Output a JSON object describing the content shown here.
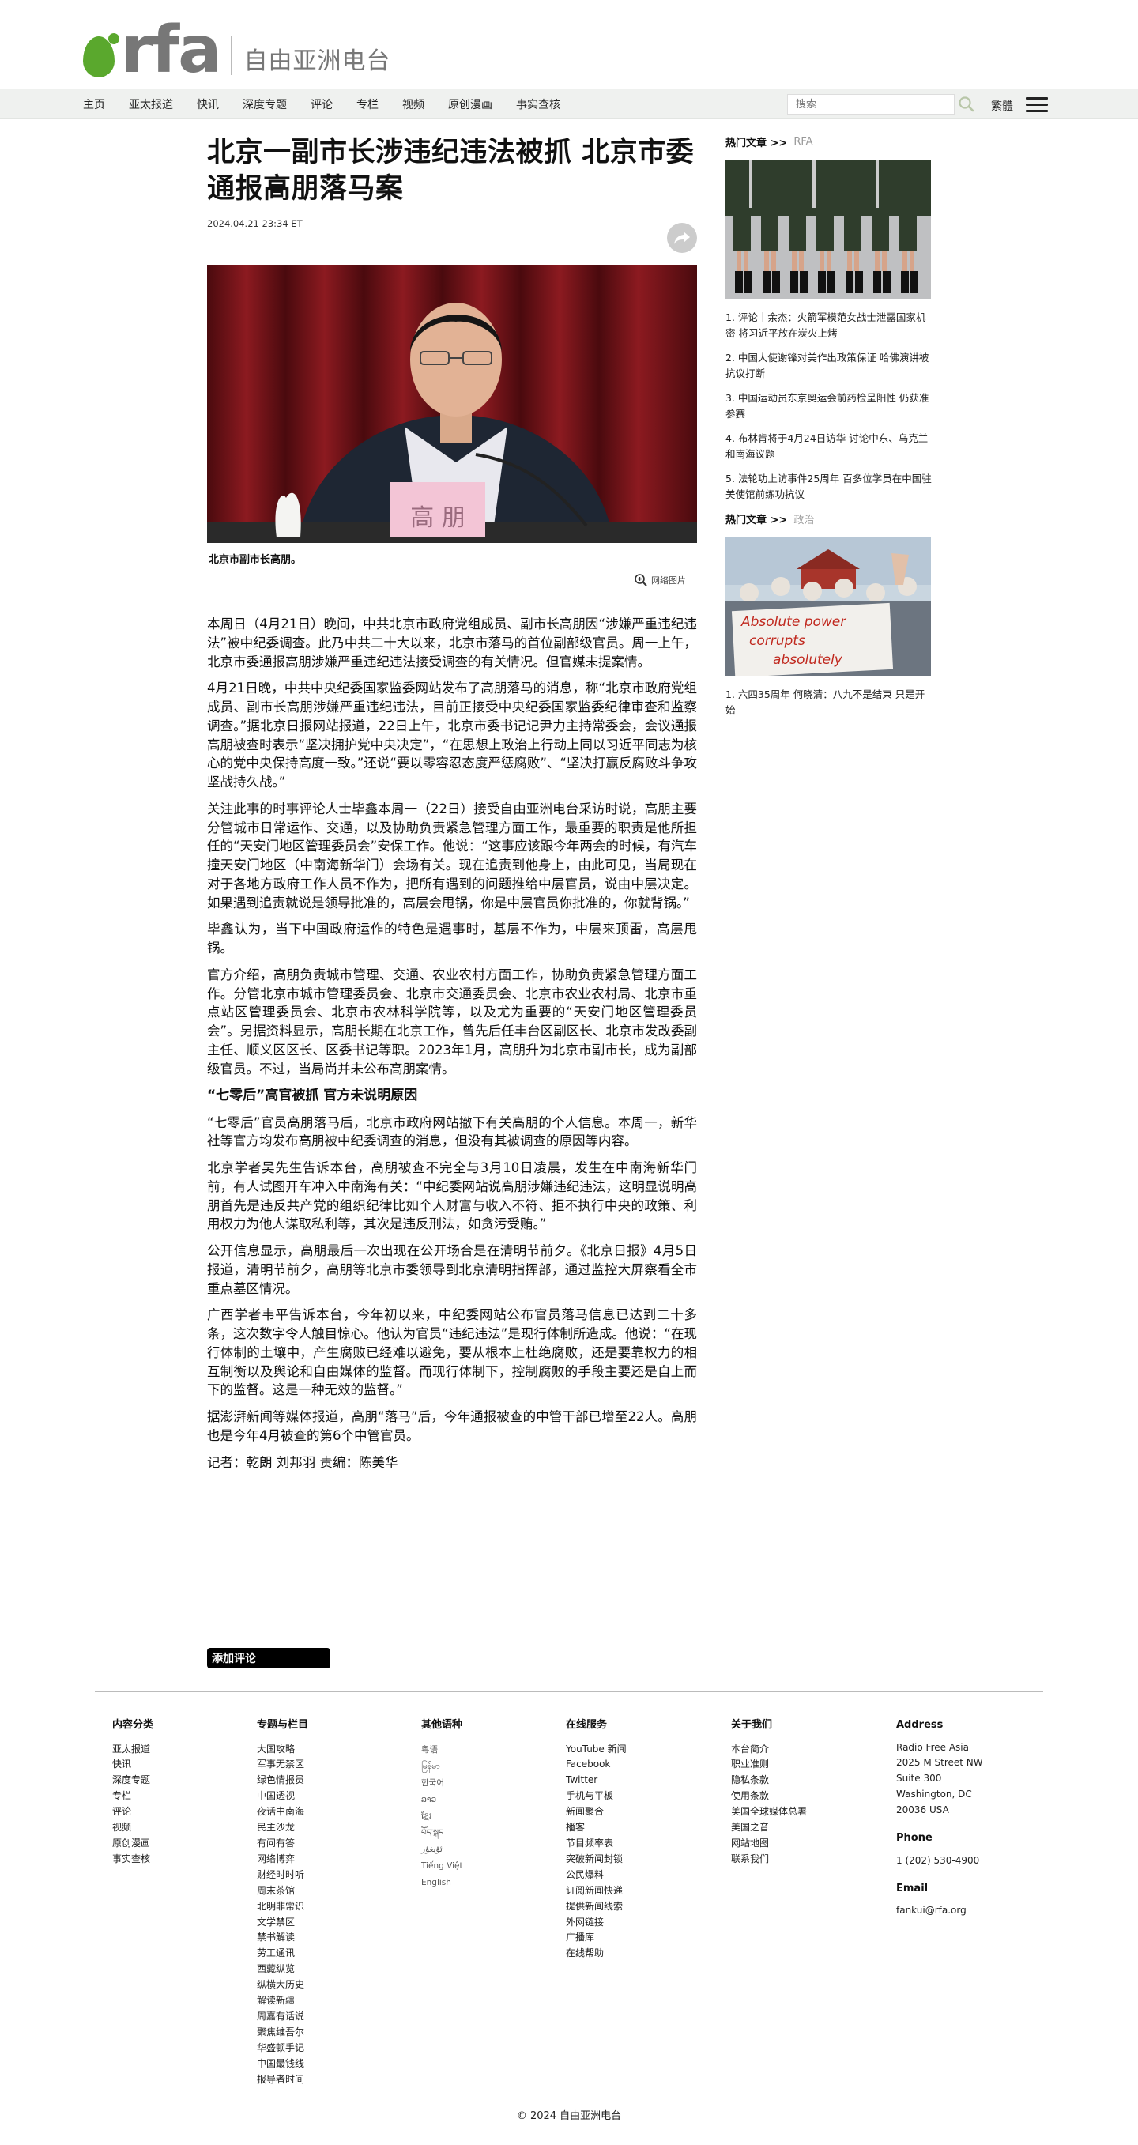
{
  "header": {
    "logo_text": "rfa",
    "logo_subtitle": "自由亚洲电台",
    "nav": [
      "主页",
      "亚太报道",
      "快讯",
      "深度专题",
      "评论",
      "专栏",
      "视频",
      "原创漫画",
      "事实查核"
    ],
    "search_placeholder": "搜索",
    "lang_switch": "繁體"
  },
  "article": {
    "title": "北京一副市长涉违纪违法被抓 北京市委通报高朋落马案",
    "date": "2024.04.21 23:34 ET",
    "caption": "北京市副市长高朋。",
    "photo_credit": "网络图片",
    "image_nameplate": "高 朋",
    "paragraphs": [
      "本周日（4月21日）晚间，中共北京市政府党组成员、副市长高朋因“涉嫌严重违纪违法”被中纪委调查。此乃中共二十大以来，北京市落马的首位副部级官员。周一上午，北京市委通报高朋涉嫌严重违纪违法接受调查的有关情况。但官媒未提案情。",
      "4月21日晚，中共中央纪委国家监委网站发布了高朋落马的消息，称“北京市政府党组成员、副市长高朋涉嫌严重违纪违法，目前正接受中央纪委国家监委纪律审查和监察调查。”据北京日报网站报道，22日上午，北京市委书记记尹力主持常委会，会议通报高朋被查时表示“坚决拥护党中央决定”，“在思想上政治上行动上同以习近平同志为核心的党中央保持高度一致。”还说“要以零容忍态度严惩腐败”、“坚决打赢反腐败斗争攻坚战持久战。”",
      "关注此事的时事评论人士毕鑫本周一（22日）接受自由亚洲电台采访时说，高朋主要分管城市日常运作、交通，以及协助负责紧急管理方面工作，最重要的职责是他所担任的“天安门地区管理委员会”安保工作。他说：“这事应该跟今年两会的时候，有汽车撞天安门地区（中南海新华门）会场有关。现在追责到他身上，由此可见，当局现在对于各地方政府工作人员不作为，把所有遇到的问题推给中层官员，说由中层决定。如果遇到追责就说是领导批准的，高层会甩锅，你是中层官员你批准的，你就背锅。”",
      "毕鑫认为，当下中国政府运作的特色是遇事时，基层不作为，中层来顶雷，高层甩锅。",
      "官方介绍，高朋负责城市管理、交通、农业农村方面工作，协助负责紧急管理方面工作。分管北京市城市管理委员会、北京市交通委员会、北京市农业农村局、北京市重点站区管理委员会、北京市农林科学院等，以及尤为重要的“天安门地区管理委员会”。另据资料显示，高朋长期在北京工作，曾先后任丰台区副区长、北京市发改委副主任、顺义区区长、区委书记等职。2023年1月，高朋升为北京市副市长，成为副部级官员。不过，当局尚并未公布高朋案情。"
    ],
    "subheading": "“七零后”高官被抓 官方未说明原因",
    "paragraphs2": [
      "“七零后”官员高朋落马后，北京市政府网站撤下有关高朋的个人信息。本周一，新华社等官方均发布高朋被中纪委调查的消息，但没有其被调查的原因等内容。",
      "北京学者吴先生告诉本台，高朋被查不完全与3月10日凌晨，发生在中南海新华门前，有人试图开车冲入中南海有关：“中纪委网站说高朋涉嫌违纪违法，这明显说明高朋首先是违反共产党的组织纪律比如个人财富与收入不符、拒不执行中央的政策、利用权力为他人谋取私利等，其次是违反刑法，如贪污受贿。”",
      "公开信息显示，高朋最后一次出现在公开场合是在清明节前夕。《北京日报》4月5日报道，清明节前夕，高朋等北京市委领导到北京清明指挥部，通过监控大屏察看全市重点墓区情况。",
      "广西学者韦平告诉本台，今年初以来，中纪委网站公布官员落马信息已达到二十多条，这次数字令人触目惊心。他认为官员“违纪违法”是现行体制所造成。他说：“在现行体制的土壤中，产生腐败已经难以避免，要从根本上杜绝腐败，还是要靠权力的相互制衡以及舆论和自由媒体的监督。而现行体制下，控制腐败的手段主要还是自上而下的监督。这是一种无效的监督。”",
      "据澎湃新闻等媒体报道，高朋“落马”后，今年通报被查的中管干部已增至22人。高朋也是今年4月被查的第6个中管官员。",
      "记者：乾朗 刘邦羽 责编：陈美华"
    ],
    "comment_button": "添加评论"
  },
  "sidebar": {
    "section1": {
      "label": "热门文章 >>",
      "tag": "RFA",
      "items": [
        "1. 评论｜余杰：火箭军模范女战士泄露国家机密 将习近平放在炭火上烤",
        "2. 中国大使谢锋对美作出政策保证 哈佛演讲被抗议打断",
        "3. 中国运动员东京奥运会前药检呈阳性 仍获准参赛",
        "4. 布林肯将于4月24日访华 讨论中东、乌克兰和南海议题",
        "5. 法轮功上访事件25周年 百多位学员在中国驻美使馆前练功抗议"
      ]
    },
    "section2": {
      "label": "热门文章 >>",
      "tag": "政治",
      "sign_line1": "Absolute power",
      "sign_line2": "corrupts",
      "sign_line3": "absolutely",
      "items": [
        "1. 六四35周年 何晓清：八九不是结束 只是开始"
      ]
    }
  },
  "footer": {
    "col1": {
      "title": "内容分类",
      "items": [
        "亚太报道",
        "快讯",
        "深度专题",
        "专栏",
        "评论",
        "视频",
        "原创漫画",
        "事实查核"
      ]
    },
    "col2": {
      "title": "专题与栏目",
      "items": [
        "大国攻略",
        "军事无禁区",
        "绿色情报员",
        "中国透视",
        "夜话中南海",
        "民主沙龙",
        "有问有答",
        "网络博弈",
        "财经时时听",
        "周末茶馆",
        "北明非常识",
        "文学禁区",
        "禁书解读",
        "劳工通讯",
        "西藏纵览",
        "纵横大历史",
        "解读新疆",
        "周嘉有话说",
        "聚焦维吾尔",
        "华盛顿手记",
        "中国最钱线",
        "报导者时间"
      ]
    },
    "col3": {
      "title": "其他语种",
      "items": [
        "粤语",
        "မြန်မာ",
        "한국어",
        "ລາວ",
        "ខ្មែរ",
        "བོད་སྐད",
        "ئۇيغۇر",
        "Tiếng Việt",
        "English"
      ]
    },
    "col4": {
      "title": "在线服务",
      "items": [
        "YouTube 新闻",
        "Facebook",
        "Twitter",
        "手机与平板",
        "新闻聚合",
        "播客",
        "节目频率表",
        "突破新闻封锁",
        "公民爆料",
        "订阅新闻快递",
        "提供新闻线索",
        "外网链接",
        "广播库",
        "在线帮助"
      ]
    },
    "col5": {
      "title": "关于我们",
      "items": [
        "本台简介",
        "职业准则",
        "隐私条款",
        "使用条款",
        "美国全球媒体总署",
        "美国之音",
        "网站地图",
        "联系我们"
      ]
    },
    "col6": {
      "address_title": "Address",
      "address_lines": [
        "Radio Free Asia",
        "2025 M Street NW",
        "Suite 300",
        "Washington, DC",
        "20036 USA"
      ],
      "phone_title": "Phone",
      "phone": "1 (202) 530-4900",
      "email_title": "Email",
      "email": "fankui@rfa.org"
    },
    "copyright": "© 2024 自由亚洲电台"
  },
  "colors": {
    "brand_green": "#5aa82d",
    "logo_gray": "#777777",
    "nav_bg": "#eff1ef"
  }
}
